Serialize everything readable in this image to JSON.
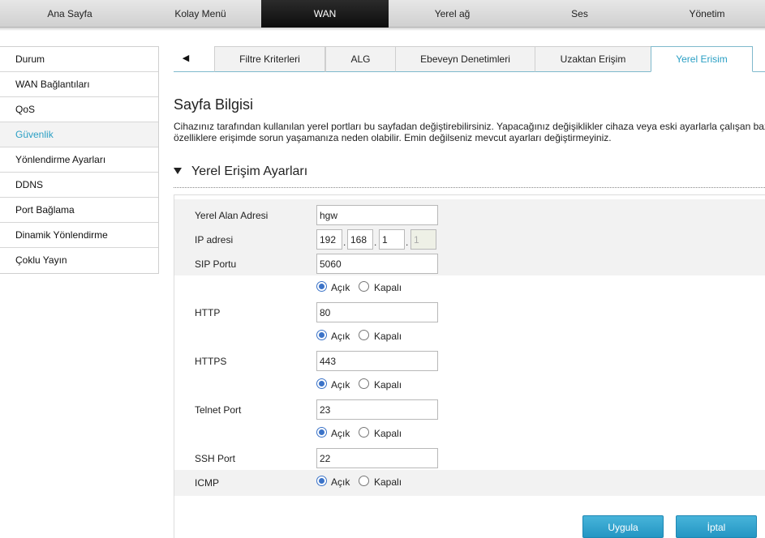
{
  "topnav": {
    "items": [
      "Ana Sayfa",
      "Kolay Menü",
      "WAN",
      "Yerel ağ",
      "Ses",
      "Yönetim"
    ],
    "active": "WAN"
  },
  "sidebar": {
    "items": [
      "Durum",
      "WAN Bağlantıları",
      "QoS",
      "Güvenlik",
      "Yönlendirme Ayarları",
      "DDNS",
      "Port Bağlama",
      "Dinamik Yönlendirme",
      "Çoklu Yayın"
    ],
    "active": "Güvenlik"
  },
  "tabs": {
    "items": [
      "Filtre Kriterleri",
      "ALG",
      "Ebeveyn Denetimleri",
      "Uzaktan Erişim",
      "Yerel Erisim"
    ],
    "active": "Yerel Erisim"
  },
  "page": {
    "title": "Sayfa Bilgisi",
    "description_line1": "Cihazınız tarafından kullanılan yerel portları bu sayfadan değiştirebilirsiniz. Yapacağınız değişiklikler cihaza veya eski ayarlarla çalışan baz",
    "description_line2": "özelliklere erişimde sorun yaşamanıza neden olabilir. Emin değilseniz mevcut ayarları değiştirmeyiniz."
  },
  "section": {
    "title": "Yerel Erişim Ayarları"
  },
  "form": {
    "lan_name_label": "Yerel Alan Adresi",
    "lan_name_value": "hgw",
    "ip_label": "IP adresi",
    "ip_octets": [
      "192",
      "168",
      "1",
      "1"
    ],
    "ip_separator": ".",
    "sip_label": "SIP Portu",
    "sip_value": "5060",
    "open_label": "Açık",
    "closed_label": "Kapalı",
    "http_label": "HTTP",
    "http_value": "80",
    "https_label": "HTTPS",
    "https_value": "443",
    "telnet_label": "Telnet Port",
    "telnet_value": "23",
    "ssh_label": "SSH Port",
    "ssh_value": "22",
    "icmp_label": "ICMP"
  },
  "buttons": {
    "apply": "Uygula",
    "cancel": "İptal"
  },
  "colors": {
    "accent": "#2a9fc4",
    "button": "#2496c3"
  }
}
